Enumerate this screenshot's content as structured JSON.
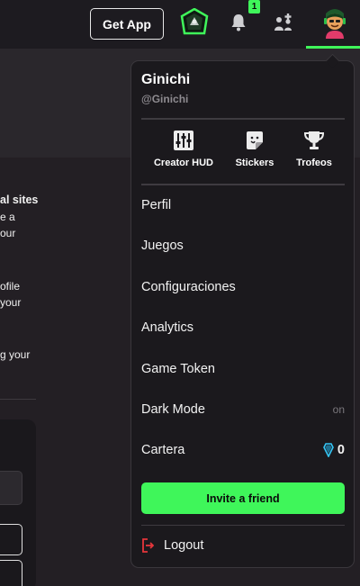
{
  "topbar": {
    "get_app_label": "Get App",
    "notifications_count": "1",
    "icons": [
      "badge-avatar-icon",
      "bell-icon",
      "friends-icon",
      "user-avatar-icon"
    ],
    "accent": "#3ff65a"
  },
  "background_page": {
    "lines": [
      "al sites",
      "e a",
      "our",
      "ofile",
      "your",
      "g your"
    ]
  },
  "dropdown": {
    "username": "Ginichi",
    "handle": "@Ginichi",
    "shortcuts": [
      {
        "label": "Creator HUD",
        "icon": "equalizer-icon"
      },
      {
        "label": "Stickers",
        "icon": "sticker-icon"
      },
      {
        "label": "Trofeos",
        "icon": "trophy-icon"
      }
    ],
    "items": [
      {
        "label": "Perfil"
      },
      {
        "label": "Juegos"
      },
      {
        "label": "Configuraciones"
      },
      {
        "label": "Analytics"
      },
      {
        "label": "Game Token"
      },
      {
        "label": "Dark Mode",
        "value": "on"
      },
      {
        "label": "Cartera",
        "value": "0",
        "icon": "gem-icon"
      }
    ],
    "invite_label": "Invite a friend",
    "logout_label": "Logout",
    "colors": {
      "invite_bg": "#3ff65a",
      "logout_icon": "#e5363b",
      "gem": "#35c6f5"
    }
  }
}
